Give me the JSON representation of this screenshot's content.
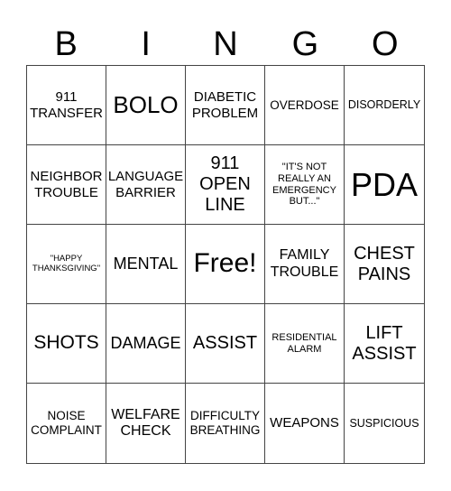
{
  "header": [
    "B",
    "I",
    "N",
    "G",
    "O"
  ],
  "cells": [
    "911 TRANSFER",
    "BOLO",
    "DIABETIC PROBLEM",
    "OVERDOSE",
    "DISORDERLY",
    "NEIGHBOR TROUBLE",
    "LANGUAGE BARRIER",
    "911 OPEN LINE",
    "\"IT'S NOT REALLY AN EMERGENCY BUT...\"",
    "PDA",
    "\"HAPPY THANKSGIVING\"",
    "MENTAL",
    "Free!",
    "FAMILY TROUBLE",
    "CHEST PAINS",
    "SHOTS",
    "DAMAGE",
    "ASSIST",
    "RESIDENTIAL ALARM",
    "LIFT ASSIST",
    "NOISE COMPLAINT",
    "WELFARE CHECK",
    "DIFFICULTY BREATHING",
    "WEAPONS",
    "SUSPICIOUS"
  ]
}
